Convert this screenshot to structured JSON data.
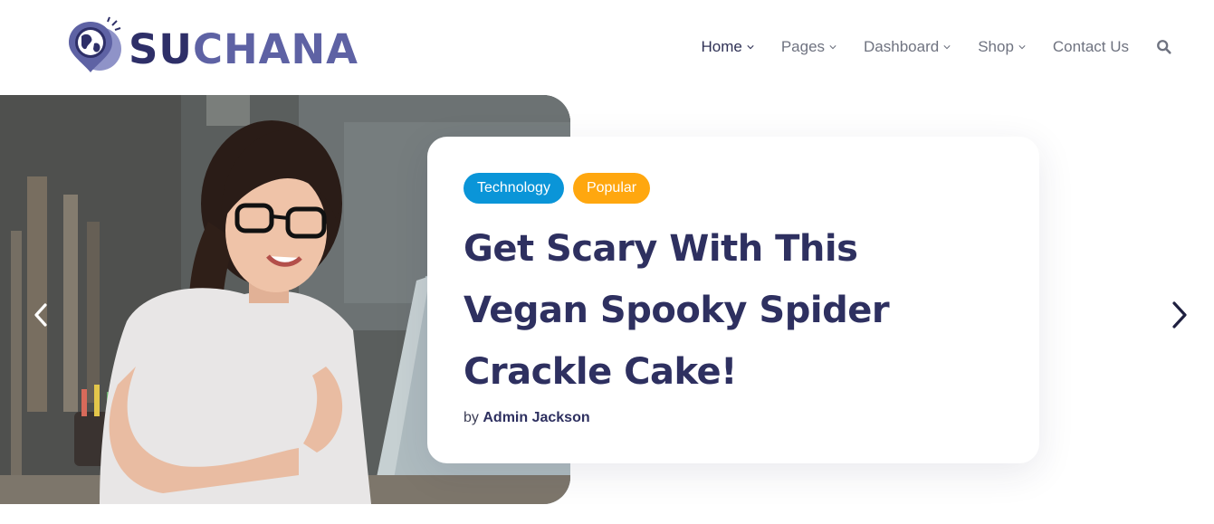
{
  "brand": {
    "logo_prefix": "SU",
    "logo_suffix": "CHANA",
    "logo_icon": "globe-pin-icon",
    "colors": {
      "dark": "#2e2f68",
      "light": "#5e62a4"
    }
  },
  "nav": {
    "items": [
      {
        "label": "Home",
        "active": true,
        "has_dropdown": true
      },
      {
        "label": "Pages",
        "active": false,
        "has_dropdown": true
      },
      {
        "label": "Dashboard",
        "active": false,
        "has_dropdown": true
      },
      {
        "label": "Shop",
        "active": false,
        "has_dropdown": true
      },
      {
        "label": "Contact Us",
        "active": false,
        "has_dropdown": false
      }
    ],
    "search_icon": "search-icon"
  },
  "hero": {
    "image_alt": "woman with glasses using laptop",
    "tags": [
      {
        "label": "Technology",
        "color": "#0a95d8"
      },
      {
        "label": "Popular",
        "color": "#ffa70f"
      }
    ],
    "title_lines": [
      "Get Scary With This",
      "Vegan Spooky Spider",
      "Crackle Cake!"
    ],
    "byline_prefix": "by",
    "author": "Admin Jackson",
    "prev_icon": "chevron-left-icon",
    "next_icon": "chevron-right-icon"
  }
}
